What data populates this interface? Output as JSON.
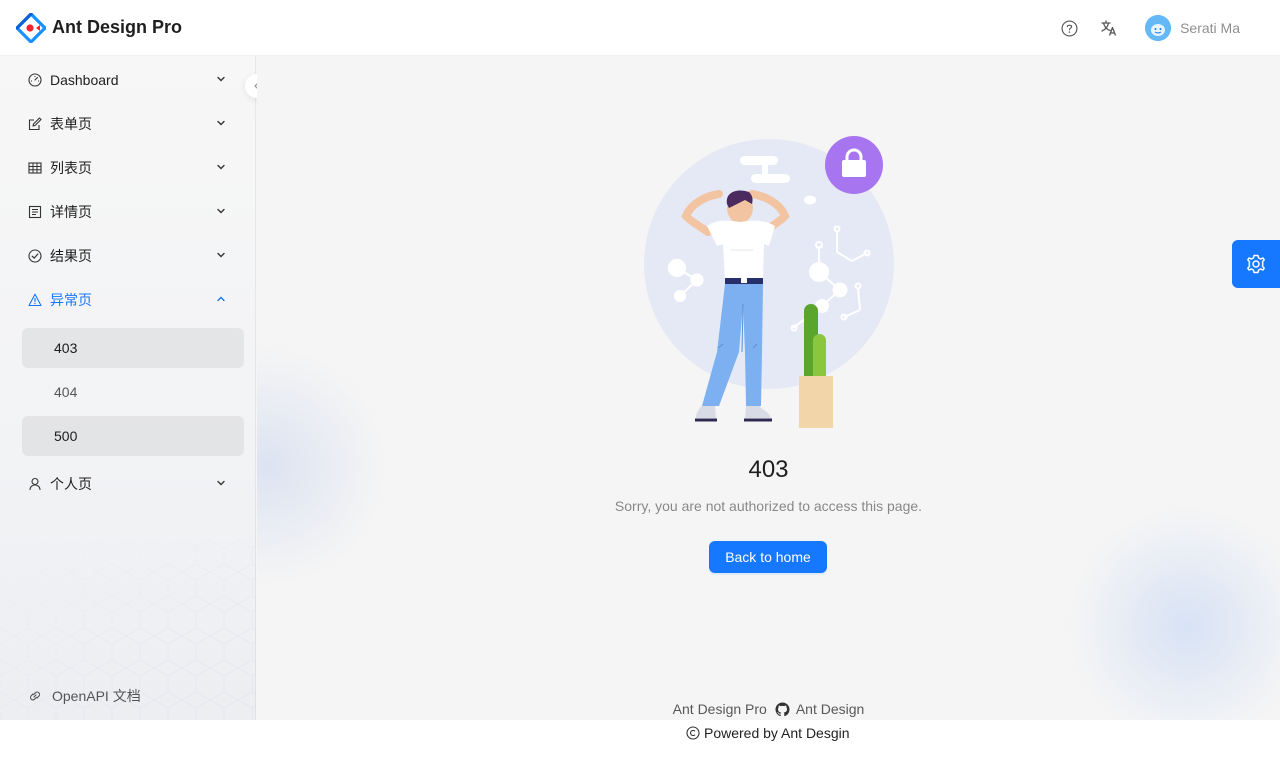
{
  "header": {
    "app_title": "Ant Design Pro",
    "icons": [
      "question-circle-icon",
      "translation-icon"
    ],
    "user_name": "Serati Ma"
  },
  "sidebar": {
    "items": [
      {
        "label": "Dashboard",
        "icon": "dashboard-icon"
      },
      {
        "label": "表单页",
        "icon": "form-icon"
      },
      {
        "label": "列表页",
        "icon": "table-icon"
      },
      {
        "label": "详情页",
        "icon": "profile-icon"
      },
      {
        "label": "结果页",
        "icon": "check-circle-icon"
      },
      {
        "label": "异常页",
        "icon": "warning-icon"
      },
      {
        "label": "个人页",
        "icon": "user-icon"
      }
    ],
    "exception_sub": [
      "403",
      "404",
      "500"
    ],
    "openapi_label": "OpenAPI 文档"
  },
  "result": {
    "status": "403",
    "subtitle": "Sorry, you are not authorized to access this page.",
    "button": "Back to home"
  },
  "footer": {
    "link1": "Ant Design Pro",
    "link2": "Ant Design",
    "copyright": "Powered by Ant Desgin"
  },
  "colors": {
    "primary": "#1677ff",
    "lock_badge": "#a875f0"
  }
}
